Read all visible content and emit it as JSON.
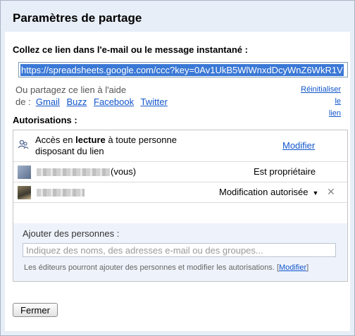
{
  "dialog": {
    "title": "Paramètres de partage"
  },
  "link_section": {
    "label": "Collez ce lien dans l'e-mail ou le message instantané :",
    "url": "https://spreadsheets.google.com/ccc?key=0Av1UkB5WlWnxdDcyWnZ6WkR1V"
  },
  "share": {
    "line1": "Ou partagez ce lien à l'aide",
    "line2_prefix": "de :",
    "services": [
      "Gmail",
      "Buzz",
      "Facebook",
      "Twitter"
    ],
    "reset_line1": "Réinitialiser le",
    "reset_line2": "lien"
  },
  "permissions": {
    "label": "Autorisations :",
    "link_access": {
      "prefix": "Accès en",
      "bold": "lecture",
      "suffix": "à toute personne",
      "line2": "disposant du lien",
      "action": "Modifier"
    },
    "people": [
      {
        "name_suffix": "(vous)",
        "role": "Est propriétaire"
      },
      {
        "name_suffix": "",
        "role": "Modification autorisée",
        "removable": true
      }
    ]
  },
  "add_people": {
    "label": "Ajouter des personnes :",
    "placeholder": "Indiquez des noms, des adresses e-mail ou des groupes...",
    "note": "Les éditeurs pourront ajouter des personnes et modifier les autorisations.",
    "note_link_open": "[",
    "note_link": "Modifier",
    "note_link_close": "]"
  },
  "footer": {
    "close_label": "Fermer"
  },
  "icons": {
    "link_access": "people-icon",
    "remove": "close-icon",
    "dropdown": "caret-down-icon"
  },
  "colors": {
    "header_bg": "#e8eef7",
    "link": "#1155cc",
    "selection": "#3a78d6",
    "panel_bg": "#eef3fb"
  }
}
